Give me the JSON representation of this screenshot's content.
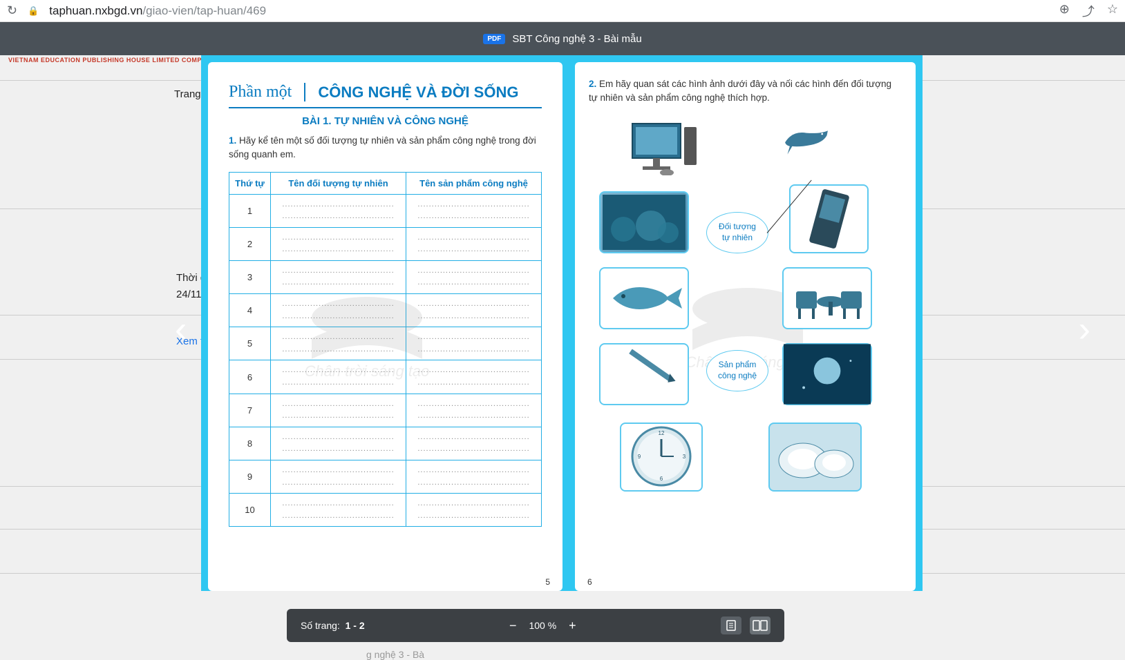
{
  "browser": {
    "url_host": "taphuan.nxbgd.vn",
    "url_path": "/giao-vien/tap-huan/469"
  },
  "header": {
    "badge": "PDF",
    "title": "SBT Công nghệ 3 - Bài mẫu"
  },
  "publisher": "VIETNAM EDUCATION PUBLISHING HOUSE LIMITED COMPANY",
  "bg": {
    "trang": "Trang",
    "thoi": "Thời g",
    "date": "24/11",
    "xem": "Xem t"
  },
  "left_page": {
    "part": "Phần một",
    "section": "CÔNG NGHỆ VÀ ĐỜI SỐNG",
    "lesson": "BÀI 1. TỰ NHIÊN VÀ CÔNG NGHỆ",
    "q1_num": "1.",
    "q1_text": " Hãy kể tên một số đối tượng tự nhiên và sản phẩm công nghệ trong đời sống quanh em.",
    "th1": "Thứ tự",
    "th2": "Tên đối tượng tự nhiên",
    "th3": "Tên sản phẩm công nghệ",
    "rows": [
      "1",
      "2",
      "3",
      "4",
      "5",
      "6",
      "7",
      "8",
      "9",
      "10"
    ],
    "pagenum": "5"
  },
  "right_page": {
    "q2_num": "2.",
    "q2_text": " Em hãy quan sát các hình ảnh dưới đây và nối các hình đến đối tượng tự nhiên và sản phẩm công nghệ thích hợp.",
    "oval1_l1": "Đối tượng",
    "oval1_l2": "tự nhiên",
    "oval2_l1": "Sản phẩm",
    "oval2_l2": "công nghệ",
    "pagenum": "6"
  },
  "watermark": "Chân trời sáng tạo",
  "toolbar": {
    "pages_label": "Số trang:",
    "pages_value": "1 - 2",
    "zoom": "100 %",
    "under_text": "g nghệ 3 - Bà"
  }
}
